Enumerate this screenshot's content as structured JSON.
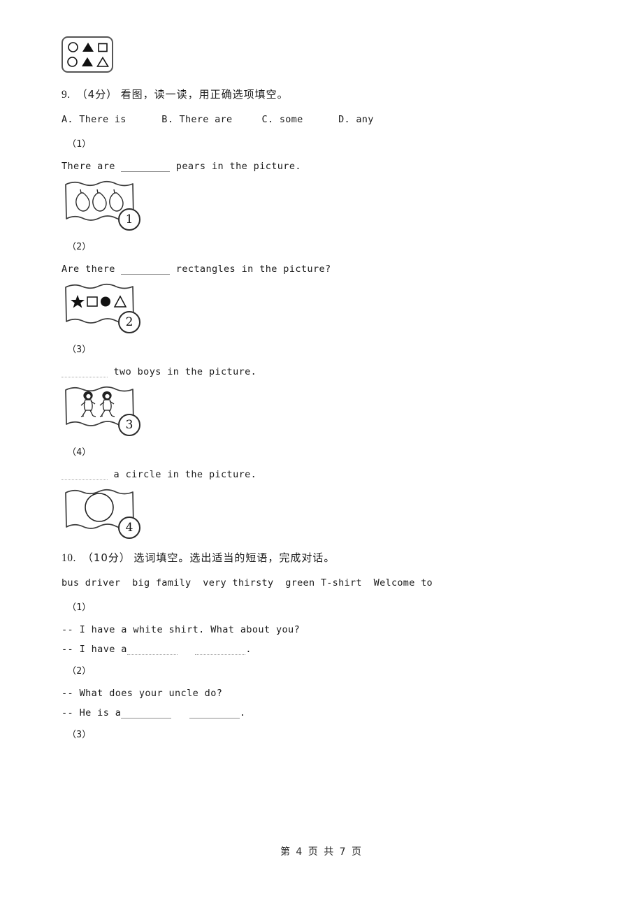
{
  "document": {
    "footer": "第 4 页 共 7 页"
  },
  "top_figure": {
    "name": "shapes-grid-image",
    "rows": [
      [
        "circle-outline",
        "triangle-filled",
        "square-outline"
      ],
      [
        "circle-outline",
        "triangle-filled",
        "triangle-outline"
      ]
    ]
  },
  "question9": {
    "number": "9.",
    "points": "（4分）",
    "prompt": "看图，读一读，用正确选项填空。",
    "options_line": "A. There is      B. There are     C. some      D. any",
    "items": [
      {
        "label": "（1）",
        "text_before": "There are ",
        "text_after": " pears in the picture.",
        "blank_first": false,
        "picture": {
          "badge": "1",
          "content": "three-pears"
        }
      },
      {
        "label": "（2）",
        "text_before": "Are there ",
        "text_after": " rectangles in the picture?",
        "blank_first": false,
        "picture": {
          "badge": "2",
          "content": "star-square-circle-triangle"
        }
      },
      {
        "label": "（3）",
        "text_before": "",
        "text_after": " two boys in the picture.",
        "blank_first": true,
        "picture": {
          "badge": "3",
          "content": "two-running-boys"
        }
      },
      {
        "label": "（4）",
        "text_before": "",
        "text_after": " a circle in the picture.",
        "blank_first": true,
        "picture": {
          "badge": "4",
          "content": "one-circle"
        }
      }
    ]
  },
  "question10": {
    "number": "10.",
    "points": "（10分）",
    "prompt": "选词填空。选出适当的短语，完成对话。",
    "word_bank": "bus driver  big family  very thirsty  green T-shirt  Welcome to",
    "items": [
      {
        "label": "（1）",
        "line1": "-- I have a white shirt. What about you?",
        "line2_before": "-- I have a",
        "line2_mid": "   ",
        "line2_after": "."
      },
      {
        "label": "（2）",
        "line1": "-- What does your uncle do?",
        "line2_before": "-- He is a",
        "line2_mid": "   ",
        "line2_after": "."
      },
      {
        "label": "（3）",
        "line1": "",
        "line2_before": "",
        "line2_mid": "",
        "line2_after": ""
      }
    ]
  }
}
